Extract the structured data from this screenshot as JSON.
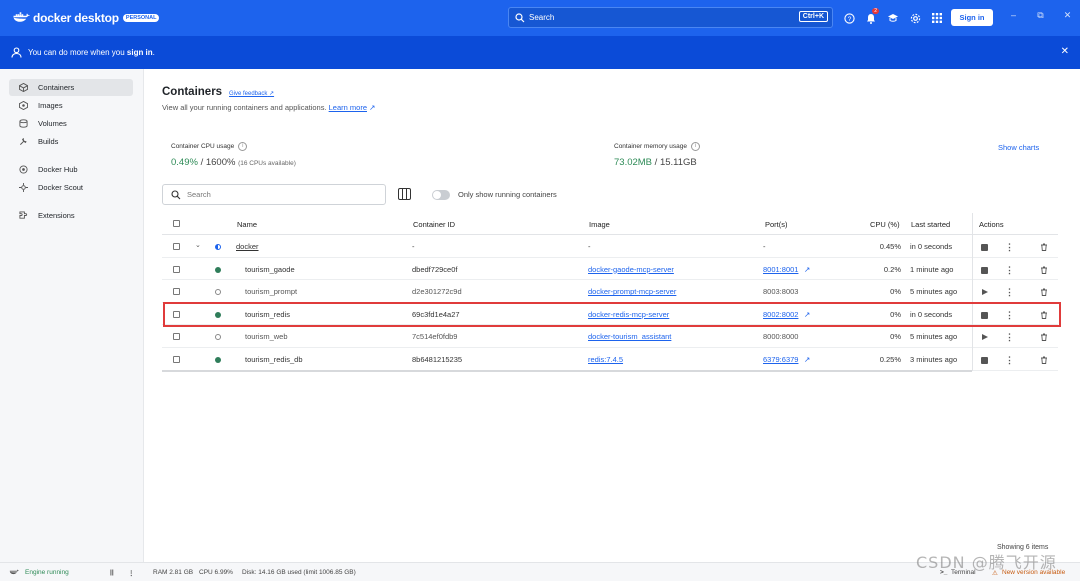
{
  "titlebar": {
    "brand": "docker desktop",
    "badge": "PERSONAL",
    "search_label": "Search",
    "search_shortcut": "Ctrl+K",
    "notification_count": "2",
    "signin_label": "Sign in"
  },
  "banner": {
    "text_prefix": "You can do more when you ",
    "text_bold": "sign in",
    "text_suffix": "."
  },
  "sidebar": {
    "items": [
      {
        "label": "Containers",
        "icon": "containers-icon",
        "active": true
      },
      {
        "label": "Images",
        "icon": "images-icon"
      },
      {
        "label": "Volumes",
        "icon": "volumes-icon"
      },
      {
        "label": "Builds",
        "icon": "builds-icon"
      },
      {
        "label": "Docker Hub",
        "icon": "docker-hub-icon"
      },
      {
        "label": "Docker Scout",
        "icon": "docker-scout-icon"
      },
      {
        "label": "Extensions",
        "icon": "extensions-icon"
      }
    ]
  },
  "main": {
    "title": "Containers",
    "feedback": "Give feedback",
    "subtitle": "View all your running containers and applications.",
    "learn_more": "Learn more",
    "cpu_label": "Container CPU usage",
    "cpu_used": "0.49%",
    "cpu_total": " / 1600%",
    "cpu_note": "(16 CPUs available)",
    "mem_label": "Container memory usage",
    "mem_used": "73.02MB",
    "mem_total": " / 15.11GB",
    "show_charts": "Show charts",
    "search_placeholder": "Search",
    "toggle_label": "Only show running containers",
    "showing": "Showing 6 items"
  },
  "table": {
    "headers": {
      "name": "Name",
      "container_id": "Container ID",
      "image": "Image",
      "ports": "Port(s)",
      "cpu": "CPU (%)",
      "last_started": "Last started",
      "actions": "Actions"
    },
    "rows": [
      {
        "name": "docker",
        "id": "-",
        "image": "-",
        "ports": "-",
        "cpu": "0.45%",
        "last": "in 0 seconds",
        "status": "group"
      },
      {
        "name": "tourism_gaode",
        "id": "dbedf729ce0f",
        "image": "docker-gaode-mcp-server",
        "ports": "8001:8001",
        "cpu": "0.2%",
        "last": "1 minute ago",
        "status": "running"
      },
      {
        "name": "tourism_prompt",
        "id": "d2e301272c9d",
        "image": "docker-prompt-mcp-server",
        "ports": "8003:8003",
        "cpu": "0%",
        "last": "5 minutes ago",
        "status": "stopped"
      },
      {
        "name": "tourism_redis",
        "id": "69c3fd1e4a27",
        "image": "docker-redis-mcp-server",
        "ports": "8002:8002",
        "cpu": "0%",
        "last": "in 0 seconds",
        "status": "running"
      },
      {
        "name": "tourism_web",
        "id": "7c514ef0fdb9",
        "image": "docker-tourism_assistant",
        "ports": "8000:8000",
        "cpu": "0%",
        "last": "5 minutes ago",
        "status": "stopped"
      },
      {
        "name": "tourism_redis_db",
        "id": "8b6481215235",
        "image": "redis:7.4.5",
        "ports": "6379:6379",
        "cpu": "0.25%",
        "last": "3 minutes ago",
        "status": "running"
      }
    ]
  },
  "statusbar": {
    "engine": "Engine running",
    "ram": "RAM 2.81 GB",
    "cpu": "CPU 6.99%",
    "disk": "Disk: 14.16 GB used (limit 1006.85 GB)",
    "terminal": "Terminal",
    "update": "New version available"
  },
  "watermark": "CSDN @腾飞开源",
  "colors": {
    "accent": "#1d63ed",
    "running": "#2f7d5a",
    "highlight": "#e03b3b"
  }
}
